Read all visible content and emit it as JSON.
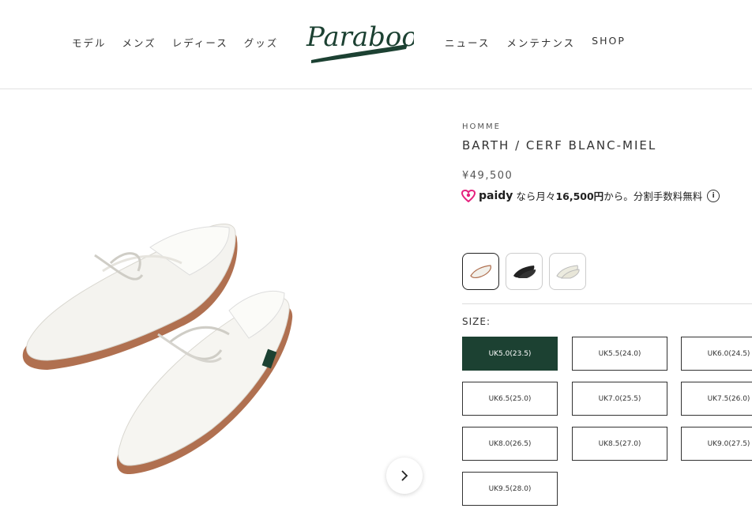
{
  "header": {
    "logo_text": "Paraboot",
    "nav_left": [
      "モデル",
      "メンズ",
      "レディース",
      "グッズ"
    ],
    "nav_right": [
      "ニュース",
      "メンテナンス",
      "SHOP"
    ]
  },
  "product": {
    "category": "HOMME",
    "title": "BARTH / CERF BLANC-MIEL",
    "price": "¥49,500",
    "paidy": {
      "brand": "paidy",
      "prefix": "なら月々",
      "amount": "16,500円",
      "suffix": "から。分割手数料無料"
    },
    "swatches": [
      {
        "name": "white",
        "active": true
      },
      {
        "name": "black",
        "active": false
      },
      {
        "name": "cream",
        "active": false
      }
    ],
    "size_label": "SIZE:",
    "sizes": [
      "UK5.0(23.5)",
      "UK5.5(24.0)",
      "UK6.0(24.5)",
      "UK6.5(25.0)",
      "UK7.0(25.5)",
      "UK7.5(26.0)",
      "UK8.0(26.5)",
      "UK8.5(27.0)",
      "UK9.0(27.5)",
      "UK9.5(28.0)"
    ],
    "selected_size": "UK5.0(23.5)"
  },
  "colors": {
    "brand_green": "#1c4132",
    "paidy_pink": "#e5227e"
  },
  "icons": {
    "next": "chevron-right-icon",
    "info": "info-icon",
    "paidy": "paidy-heart-icon"
  }
}
